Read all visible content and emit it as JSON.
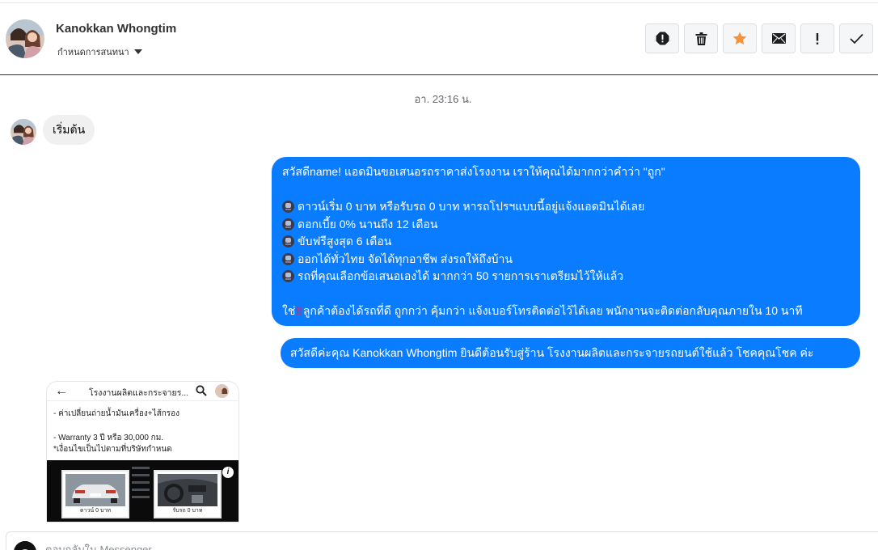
{
  "header": {
    "contact_name": "Kanokkan Whongtim",
    "subtitle": "กำหนดการสนทนา",
    "actions": [
      {
        "name": "report-icon"
      },
      {
        "name": "trash-icon"
      },
      {
        "name": "star-icon"
      },
      {
        "name": "envelope-icon"
      },
      {
        "name": "exclamation-icon"
      },
      {
        "name": "checkmark-icon"
      }
    ],
    "star_color": "#f7923a"
  },
  "conversation": {
    "timestamp": "อา. 23:16 น.",
    "incoming": {
      "text": "เริ่มต้น"
    },
    "outgoing_1": {
      "line1": "สวัสดีname! แอดมินขอเสนอรถราคาส่งโรงงาน เราให้คุณได้มากกว่าคำว่า \"ถูก\"",
      "bullets": [
        "ดาวน์เริ่ม 0 บาท หรือรับรถ 0 บาท หารถโปรฯแบบนี้อยู่แจ้งแอดมินได้เลย",
        "ดอกเบี้ย 0% นานถึง 12 เดือน",
        "ขับฟรีสูงสุด 6 เดือน",
        "ออกได้ทั่วไทย จัดได้ทุกอาชีพ ส่งรถให้ถึงบ้าน",
        "รถที่คุณเลือกข้อเสนอเองได้ มากกว่า 50 รายการเราเตรียมไว้ให้แล้ว"
      ],
      "closing_prefix": "ใช่",
      "closing_emoji": "‼",
      "closing_rest": "ลูกค้าต้องได้รถที่ดี ถูกกว่า คุ้มกว่า แจ้งเบอร์โทรติดต่อไว้ได้เลย พนักงานจะติดต่อกลับคุณภายใน 10 นาที"
    },
    "outgoing_2": {
      "text": "สวัสดีค่ะคุณ Kanokkan Whongtim ยินดีต้อนรับสู่ร้าน โรงงานผลิตและกระจายรถยนต์ใช้แล้ว โชคคุณโชค ค่ะ"
    },
    "attachment": {
      "title": "โรงงานผลิตและกระจายร...",
      "line1": "- ค่าเปลี่ยนถ่ายน้ำมันเครื่อง+ไส้กรอง",
      "line2": "- Warranty 3 ปี หรือ 30,000 กม.",
      "line3": "*เงื่อนไขเป็นไปตามที่บริษัทกำหนด",
      "card_left_caption": "ดาวน์ 0 บาท",
      "card_right_caption": "รับรถ 0 บาท",
      "info_glyph": "i"
    }
  },
  "composer": {
    "placeholder": "ตอบกลับใน Messenger"
  },
  "colors": {
    "bubble_out": "#0a7cff",
    "bubble_in": "#f0f0f0"
  }
}
